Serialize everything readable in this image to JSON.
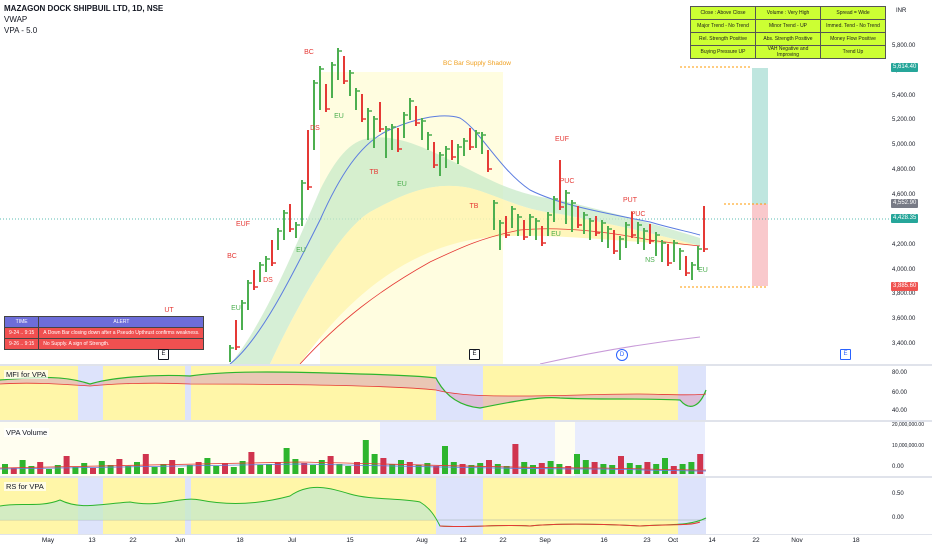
{
  "header": {
    "symbol_line": "MAZAGON DOCK SHIPBUIL LTD, 1D, NSE",
    "indicators": [
      "VWAP",
      "VPA - 5.0"
    ],
    "currency": "INR"
  },
  "status_table": [
    [
      "Close : Above Close",
      "Volume : Very High",
      "Spread = Wide"
    ],
    [
      "Major Trend - No Trend",
      "Minor Trend - UP",
      "Immed. Tend - No Trend"
    ],
    [
      "Rel. Strength Positive",
      "Abs. Strength Positive",
      "Money Flow Positive"
    ],
    [
      "Buying Pressure UP",
      "VAH Negative and Improving",
      "Trend Up"
    ]
  ],
  "alert_table": {
    "headers": [
      "TIME",
      "ALERT"
    ],
    "rows": [
      [
        "9-24 .. 9:15",
        "A Down Bar closing down after a Pseudo Upthrust confirms weakness."
      ],
      [
        "9-26 .. 9:15",
        "No Supply. A sign of Strength."
      ]
    ]
  },
  "annotations": {
    "supply_shadow": "BC Bar Supply Shadow",
    "labels": [
      "BC",
      "DS",
      "EU",
      "EUF",
      "BC",
      "EU",
      "DS",
      "TB",
      "EU",
      "TB",
      "EU",
      "EUF",
      "PUC",
      "EU",
      "PUT",
      "PUC",
      "NS",
      "EU",
      "UT"
    ]
  },
  "price_axis": {
    "ticks": [
      "5,800.00",
      "5,600.00",
      "5,400.00",
      "5,200.00",
      "5,000.00",
      "4,800.00",
      "4,600.00",
      "4,400.00",
      "4,200.00",
      "4,000.00",
      "3,800.00",
      "3,600.00",
      "3,400.00"
    ],
    "boxes": [
      {
        "value": "5,614.40",
        "color": "#26a69a"
      },
      {
        "value": "4,552.90",
        "color": "#787b86"
      },
      {
        "value": "4,428.35",
        "color": "#26a69a"
      },
      {
        "value": "3,885.60",
        "color": "#ef5350"
      }
    ]
  },
  "indicator_panes": {
    "mfi": {
      "title": "MFI for VPA",
      "ticks": [
        "80.00",
        "60.00",
        "40.00"
      ]
    },
    "volume": {
      "title": "VPA Volume",
      "ticks": [
        "20,000,000.00",
        "10,000,000.00",
        "0.00"
      ]
    },
    "rs": {
      "title": "RS for VPA",
      "ticks": [
        "0.50",
        "0.00"
      ]
    }
  },
  "time_axis": [
    "May",
    "13",
    "22",
    "Jun",
    "18",
    "Jul",
    "15",
    "Aug",
    "12",
    "22",
    "Sep",
    "16",
    "23",
    "Oct",
    "14",
    "22",
    "Nov",
    "18"
  ],
  "event_markers": [
    "E",
    "E",
    "D",
    "E"
  ],
  "colors": {
    "up": "#26a69a",
    "down": "#ef5350",
    "bull_bar": "#4caf50",
    "bear_bar": "#e53935",
    "vpa_green": "#2db52d",
    "vpa_red": "#d0344e",
    "vwap": "#5b7ce0",
    "status_bg": "#ccff33"
  }
}
